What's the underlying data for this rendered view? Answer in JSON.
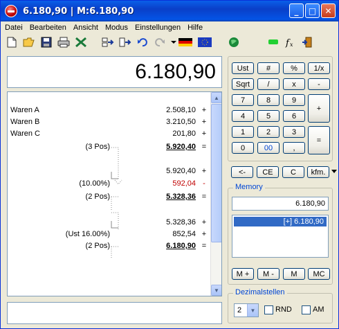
{
  "window": {
    "title": "6.180,90 | M:6.180,90"
  },
  "menu": [
    "Datei",
    "Bearbeiten",
    "Ansicht",
    "Modus",
    "Einstellungen",
    "Hilfe"
  ],
  "display": {
    "value": "6.180,90"
  },
  "tape": [
    {
      "label": "Waren A",
      "pos": "",
      "value": "2.508,10",
      "op": "+"
    },
    {
      "label": "Waren B",
      "pos": "",
      "value": "3.210,50",
      "op": "+"
    },
    {
      "label": "Waren C",
      "pos": "",
      "value": "201,80",
      "op": "+"
    },
    {
      "label": "",
      "pos": "(3 Pos)",
      "value": "5.920,40",
      "op": "="
    },
    {
      "label": "",
      "pos": "",
      "value": "",
      "op": ""
    },
    {
      "label": "",
      "pos": "",
      "value": "5.920,40",
      "op": "+"
    },
    {
      "label": "",
      "pos": "(10.00%)",
      "value": "592,04",
      "op": "-"
    },
    {
      "label": "",
      "pos": "(2 Pos)",
      "value": "5.328,36",
      "op": "="
    },
    {
      "label": "",
      "pos": "",
      "value": "",
      "op": ""
    },
    {
      "label": "",
      "pos": "",
      "value": "5.328,36",
      "op": "+"
    },
    {
      "label": "",
      "pos": "(Ust 16.00%)",
      "value": "852,54",
      "op": "+"
    },
    {
      "label": "",
      "pos": "(2 Pos)",
      "value": "6.180,90",
      "op": "="
    }
  ],
  "keys": {
    "ust": "Ust",
    "hash": "#",
    "pct": "%",
    "inv": "1/x",
    "sqrt": "Sqrt",
    "div": "/",
    "mul": "x",
    "minus": "-",
    "k7": "7",
    "k8": "8",
    "k9": "9",
    "plus": "+",
    "k4": "4",
    "k5": "5",
    "k6": "6",
    "k1": "1",
    "k2": "2",
    "k3": "3",
    "eq": "=",
    "k0": "0",
    "k00": "00",
    "comma": ","
  },
  "controls": {
    "back": "<-",
    "ce": "CE",
    "c": "C",
    "kfm": "kfm."
  },
  "memory": {
    "title": "Memory",
    "value": "6.180,90",
    "list_item": "[+] 6.180,90",
    "mplus": "M +",
    "mminus": "M -",
    "m": "M",
    "mc": "MC"
  },
  "decimals": {
    "title": "Dezimalstellen",
    "value": "2",
    "rnd": "RND",
    "am": "AM"
  },
  "colors": {
    "red": "#c00000",
    "blue_accent": "#0046d5",
    "selection": "#316ac5"
  }
}
